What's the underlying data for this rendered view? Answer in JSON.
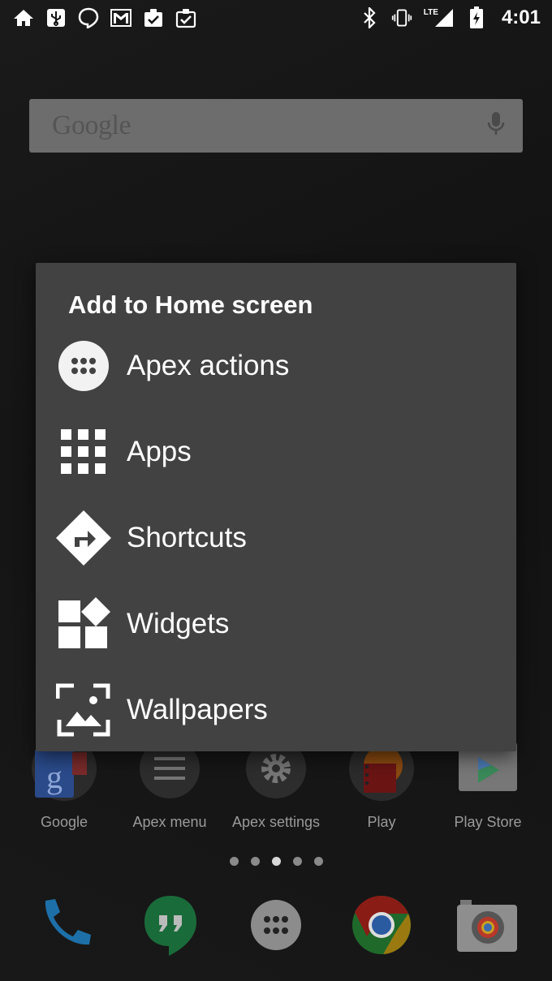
{
  "status_bar": {
    "time": "4:01",
    "network": "LTE",
    "left_icons": [
      "home-icon",
      "usb-icon",
      "hangouts-icon",
      "gmail-icon",
      "task-check-icon",
      "task-check-icon"
    ],
    "right_icons": [
      "bluetooth-icon",
      "vibrate-icon",
      "signal-icon",
      "battery-icon"
    ]
  },
  "search": {
    "logo": "Google",
    "icon": "mic-icon"
  },
  "dialog": {
    "title": "Add to Home screen",
    "options": [
      {
        "label": "Apex actions",
        "icon": "apex-actions-icon"
      },
      {
        "label": "Apps",
        "icon": "apps-grid-icon"
      },
      {
        "label": "Shortcuts",
        "icon": "shortcut-arrow-icon"
      },
      {
        "label": "Widgets",
        "icon": "widgets-icon"
      },
      {
        "label": "Wallpapers",
        "icon": "wallpaper-icon"
      }
    ]
  },
  "home_apps": [
    {
      "label": "Google"
    },
    {
      "label": "Apex menu"
    },
    {
      "label": "Apex settings"
    },
    {
      "label": "Play"
    },
    {
      "label": "Play Store"
    }
  ],
  "pager": {
    "count": 5,
    "active": 3
  },
  "hotseat": [
    "phone-icon",
    "hangouts-icon",
    "app-drawer-icon",
    "chrome-icon",
    "camera-icon"
  ],
  "colors": {
    "dialog_bg": "#424242",
    "scrim": "#121212",
    "search_bg": "#6d6d6d"
  }
}
